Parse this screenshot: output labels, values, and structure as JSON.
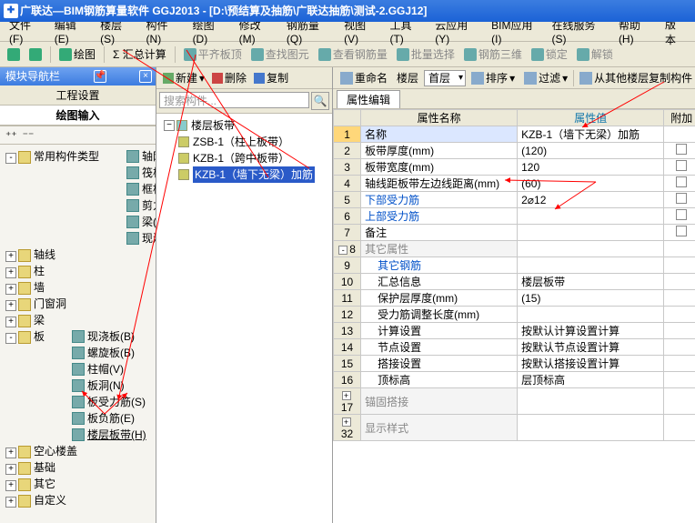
{
  "window": {
    "title": "广联达—BIM钢筋算量软件 GGJ2013 - [D:\\预结算及抽筋\\广联达抽筋\\测试-2.GGJ12]"
  },
  "menubar": [
    "文件(F)",
    "编辑(E)",
    "楼层(S)",
    "构件(N)",
    "绘图(D)",
    "修改(M)",
    "钢筋量(Q)",
    "视图(V)",
    "工具(T)",
    "云应用(Y)",
    "BIM应用(I)",
    "在线服务(S)",
    "帮助(H)",
    "版本"
  ],
  "toolbar1": {
    "left": [
      "",
      "",
      "",
      "",
      ""
    ],
    "items": [
      "绘图",
      "Σ 汇总计算",
      "平齐板顶",
      "查找图元",
      "查看钢筋量",
      "批量选择",
      "钢筋三维",
      "锁定",
      "解锁"
    ]
  },
  "nav": {
    "title": "模块导航栏",
    "tabs": [
      "工程设置",
      "绘图输入"
    ],
    "activeTab": 1,
    "tree": [
      {
        "label": "常用构件类型",
        "exp": "-",
        "children": [
          {
            "label": "轴网(J)"
          },
          {
            "label": "筏板基础(M)"
          },
          {
            "label": "框柱(Z)"
          },
          {
            "label": "剪力墙(Q)"
          },
          {
            "label": "梁(L)"
          },
          {
            "label": "现浇板(B)"
          }
        ]
      },
      {
        "label": "轴线",
        "exp": "+"
      },
      {
        "label": "柱",
        "exp": "+"
      },
      {
        "label": "墙",
        "exp": "+"
      },
      {
        "label": "门窗洞",
        "exp": "+"
      },
      {
        "label": "梁",
        "exp": "+"
      },
      {
        "label": "板",
        "exp": "-",
        "children": [
          {
            "label": "现浇板(B)"
          },
          {
            "label": "螺旋板(B)"
          },
          {
            "label": "柱帽(V)"
          },
          {
            "label": "板洞(N)"
          },
          {
            "label": "板受力筋(S)"
          },
          {
            "label": "板负筋(E)"
          },
          {
            "label": "楼层板带(H)",
            "hl": true
          }
        ]
      },
      {
        "label": "空心楼盖",
        "exp": "+"
      },
      {
        "label": "基础",
        "exp": "+"
      },
      {
        "label": "其它",
        "exp": "+"
      },
      {
        "label": "自定义",
        "exp": "+"
      }
    ]
  },
  "mid": {
    "toolbar": [
      "新建",
      "删除",
      "复制",
      "重命名",
      "楼层",
      "首层"
    ],
    "searchPlaceholder": "搜索构件...",
    "root": "楼层板带",
    "items": [
      "ZSB-1（柱上板带）",
      "KZB-1（跨中板带）",
      "KZB-1（墙下无梁）加筋"
    ],
    "selected": 2
  },
  "right": {
    "toolbar": {
      "sort": "排序",
      "filter": "过滤",
      "copy": "从其他楼层复制构件"
    },
    "tab": "属性编辑",
    "headers": {
      "name": "属性名称",
      "value": "属性值",
      "add": "附加"
    },
    "rows": [
      {
        "n": "1",
        "name": "名称",
        "val": "KZB-1（墙下无梁）加筋",
        "sel": true,
        "chk": false
      },
      {
        "n": "2",
        "name": "板带厚度(mm)",
        "val": "(120)",
        "chk": true
      },
      {
        "n": "3",
        "name": "板带宽度(mm)",
        "val": "120",
        "chk": true
      },
      {
        "n": "4",
        "name": "轴线距板带左边线距离(mm)",
        "val": "(60)",
        "chk": true
      },
      {
        "n": "5",
        "name": "下部受力筋",
        "val": "2⌀12",
        "chk": true,
        "blue": true
      },
      {
        "n": "6",
        "name": "上部受力筋",
        "val": "",
        "chk": true,
        "blue": true
      },
      {
        "n": "7",
        "name": "备注",
        "val": "",
        "chk": true
      },
      {
        "n": "8",
        "name": "其它属性",
        "val": "",
        "group": true,
        "pm": "-"
      },
      {
        "n": "9",
        "name": "其它钢筋",
        "val": "",
        "blue": true,
        "indent": true
      },
      {
        "n": "10",
        "name": "汇总信息",
        "val": "楼层板带",
        "indent": true
      },
      {
        "n": "11",
        "name": "保护层厚度(mm)",
        "val": "(15)",
        "indent": true
      },
      {
        "n": "12",
        "name": "受力筋调整长度(mm)",
        "val": "",
        "indent": true
      },
      {
        "n": "13",
        "name": "计算设置",
        "val": "按默认计算设置计算",
        "indent": true
      },
      {
        "n": "14",
        "name": "节点设置",
        "val": "按默认节点设置计算",
        "indent": true
      },
      {
        "n": "15",
        "name": "搭接设置",
        "val": "按默认搭接设置计算",
        "indent": true
      },
      {
        "n": "16",
        "name": "顶标高",
        "val": "层顶标高",
        "indent": true
      },
      {
        "n": "17",
        "name": "锚固搭接",
        "val": "",
        "group": true,
        "pm": "+"
      },
      {
        "n": "32",
        "name": "显示样式",
        "val": "",
        "group": true,
        "pm": "+"
      }
    ]
  }
}
